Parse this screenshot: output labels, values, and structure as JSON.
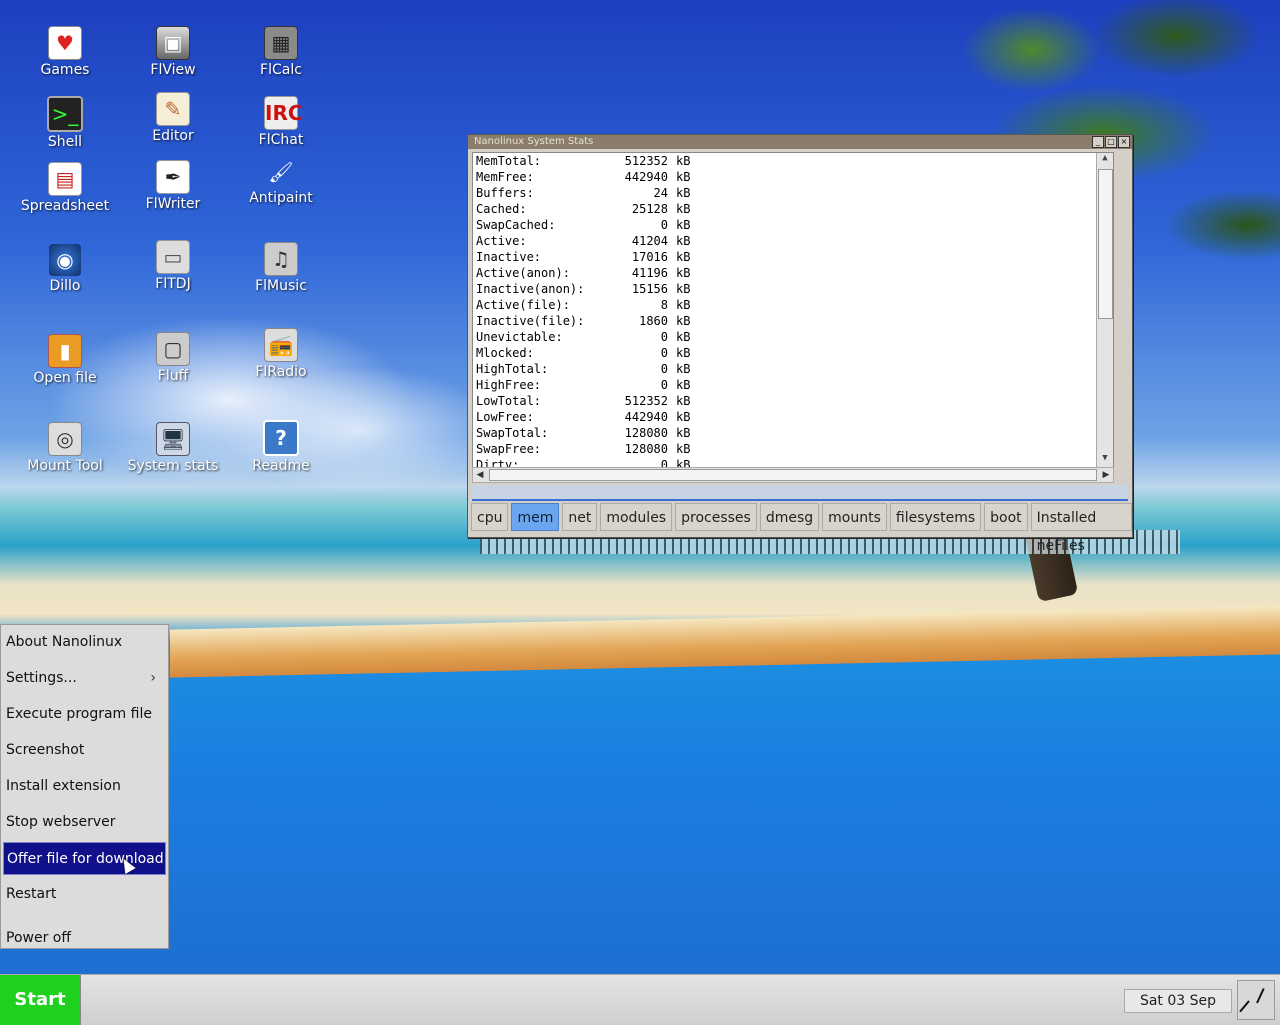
{
  "desktop": {
    "icons": [
      {
        "label": "Games",
        "glyph": "♥",
        "icon": "cards-icon"
      },
      {
        "label": "FlView",
        "glyph": "▣",
        "icon": "image-viewer-icon"
      },
      {
        "label": "FlCalc",
        "glyph": "▦",
        "icon": "calculator-icon"
      },
      {
        "label": "Shell",
        "glyph": ">_",
        "icon": "terminal-icon"
      },
      {
        "label": "Editor",
        "glyph": "✎",
        "icon": "notepad-icon"
      },
      {
        "label": "FlChat",
        "glyph": "IRC",
        "icon": "irc-chat-icon"
      },
      {
        "label": "Spreadsheet",
        "glyph": "▤",
        "icon": "spreadsheet-icon"
      },
      {
        "label": "FlWriter",
        "glyph": "✒",
        "icon": "writer-icon"
      },
      {
        "label": "Antipaint",
        "glyph": "🖌",
        "icon": "paint-icon"
      },
      {
        "label": "Dillo",
        "glyph": "◉",
        "icon": "browser-globe-icon"
      },
      {
        "label": "FlTDJ",
        "glyph": "▭",
        "icon": "todo-journal-icon"
      },
      {
        "label": "FlMusic",
        "glyph": "♫",
        "icon": "music-player-icon"
      },
      {
        "label": "Open file",
        "glyph": "▮",
        "icon": "open-file-icon"
      },
      {
        "label": "Fluff",
        "glyph": "▢",
        "icon": "file-manager-icon"
      },
      {
        "label": "FlRadio",
        "glyph": "📻",
        "icon": "radio-icon"
      },
      {
        "label": "Mount Tool",
        "glyph": "◎",
        "icon": "disk-mount-icon"
      },
      {
        "label": "System stats",
        "glyph": "🖥",
        "icon": "monitor-icon"
      },
      {
        "label": "Readme",
        "glyph": "?",
        "icon": "help-icon"
      }
    ]
  },
  "window": {
    "title": "Nanolinux System Stats",
    "buttons": {
      "minimize": "_",
      "maximize": "□",
      "close": "×"
    },
    "mem": [
      {
        "key": "MemTotal:",
        "value": "512352",
        "unit": "kB"
      },
      {
        "key": "MemFree:",
        "value": "442940",
        "unit": "kB"
      },
      {
        "key": "Buffers:",
        "value": "24",
        "unit": "kB"
      },
      {
        "key": "Cached:",
        "value": "25128",
        "unit": "kB"
      },
      {
        "key": "SwapCached:",
        "value": "0",
        "unit": "kB"
      },
      {
        "key": "Active:",
        "value": "41204",
        "unit": "kB"
      },
      {
        "key": "Inactive:",
        "value": "17016",
        "unit": "kB"
      },
      {
        "key": "Active(anon):",
        "value": "41196",
        "unit": "kB"
      },
      {
        "key": "Inactive(anon):",
        "value": "15156",
        "unit": "kB"
      },
      {
        "key": "Active(file):",
        "value": "8",
        "unit": "kB"
      },
      {
        "key": "Inactive(file):",
        "value": "1860",
        "unit": "kB"
      },
      {
        "key": "Unevictable:",
        "value": "0",
        "unit": "kB"
      },
      {
        "key": "Mlocked:",
        "value": "0",
        "unit": "kB"
      },
      {
        "key": "HighTotal:",
        "value": "0",
        "unit": "kB"
      },
      {
        "key": "HighFree:",
        "value": "0",
        "unit": "kB"
      },
      {
        "key": "LowTotal:",
        "value": "512352",
        "unit": "kB"
      },
      {
        "key": "LowFree:",
        "value": "442940",
        "unit": "kB"
      },
      {
        "key": "SwapTotal:",
        "value": "128080",
        "unit": "kB"
      },
      {
        "key": "SwapFree:",
        "value": "128080",
        "unit": "kB"
      },
      {
        "key": "Dirty:",
        "value": "0",
        "unit": "kB"
      }
    ],
    "tabs": [
      "cpu",
      "mem",
      "net",
      "modules",
      "processes",
      "dmesg",
      "mounts",
      "filesystems",
      "boot",
      "Installed neFiles"
    ],
    "active_tab": "mem"
  },
  "menu": {
    "items": [
      {
        "label": "About Nanolinux",
        "submenu": false
      },
      {
        "label": "Settings...",
        "submenu": true
      },
      {
        "label": "Execute program file",
        "submenu": false
      },
      {
        "label": "Screenshot",
        "submenu": false
      },
      {
        "label": "Install extension",
        "submenu": false
      },
      {
        "label": "Stop webserver",
        "submenu": false
      },
      {
        "label": "Offer file for download",
        "submenu": false
      },
      {
        "label": "Restart",
        "submenu": false
      },
      {
        "label": "Power off",
        "submenu": false
      }
    ],
    "selected": "Offer file for download",
    "submenu_arrow": "›"
  },
  "taskbar": {
    "start_label": "Start",
    "date": "Sat 03 Sep"
  },
  "colors": {
    "start_green": "#1fd01f",
    "menu_selection": "#10108a",
    "active_tab": "#6aa6f0"
  }
}
